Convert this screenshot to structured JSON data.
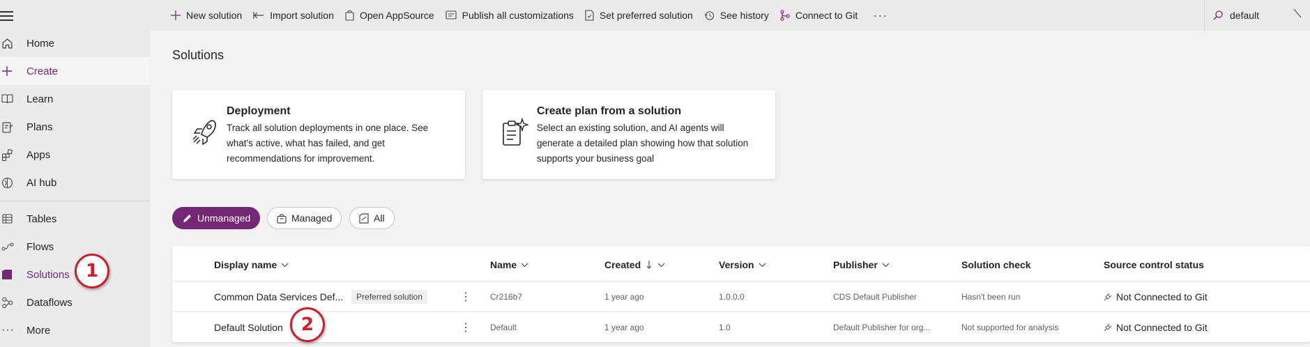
{
  "sidebar": {
    "items": [
      {
        "label": "Home",
        "icon": "home-icon"
      },
      {
        "label": "Create",
        "icon": "plus-icon"
      },
      {
        "label": "Learn",
        "icon": "book-icon"
      },
      {
        "label": "Plans",
        "icon": "plans-icon"
      },
      {
        "label": "Apps",
        "icon": "apps-icon"
      },
      {
        "label": "AI hub",
        "icon": "ai-hub-icon"
      },
      {
        "label": "Tables",
        "icon": "table-icon"
      },
      {
        "label": "Flows",
        "icon": "flows-icon"
      },
      {
        "label": "Solutions",
        "icon": "solutions-icon"
      },
      {
        "label": "Dataflows",
        "icon": "dataflows-icon"
      },
      {
        "label": "More",
        "icon": "more-icon"
      }
    ]
  },
  "toolbar": {
    "new_solution": "New solution",
    "import_solution": "Import solution",
    "open_appsource": "Open AppSource",
    "publish_all": "Publish all customizations",
    "set_preferred": "Set preferred solution",
    "see_history": "See history",
    "connect_git": "Connect to Git",
    "more": "···",
    "search_value": "default"
  },
  "main": {
    "title": "Solutions",
    "cards": [
      {
        "title": "Deployment",
        "description": "Track all solution deployments in one place. See what's active, what has failed, and get recommendations for improvement."
      },
      {
        "title": "Create plan from a solution",
        "description": "Select an existing solution, and AI agents will generate a detailed plan showing how that solution supports your business goal"
      }
    ],
    "filters": [
      "Unmanaged",
      "Managed",
      "All"
    ]
  },
  "table": {
    "headers": [
      "Display name",
      "Name",
      "Created",
      "Version",
      "Publisher",
      "Solution check",
      "Source control status"
    ],
    "rows": [
      {
        "display_name": "Common Data Services Def...",
        "badge": "Preferred solution",
        "name": "Cr216b7",
        "created": "1 year ago",
        "version": "1.0.0.0",
        "publisher": "CDS Default Publisher",
        "check": "Hasn't been run",
        "source": "Not Connected to Git"
      },
      {
        "display_name": "Default Solution",
        "badge": "",
        "name": "Default",
        "created": "1 year ago",
        "version": "1.0",
        "publisher": "Default Publisher for org...",
        "check": "Not supported for analysis",
        "source": "Not Connected to Git"
      }
    ],
    "kebab": "⋮"
  },
  "callouts": [
    "1",
    "2"
  ],
  "colors": {
    "accent": "#742774",
    "callout": "#c8202c"
  }
}
